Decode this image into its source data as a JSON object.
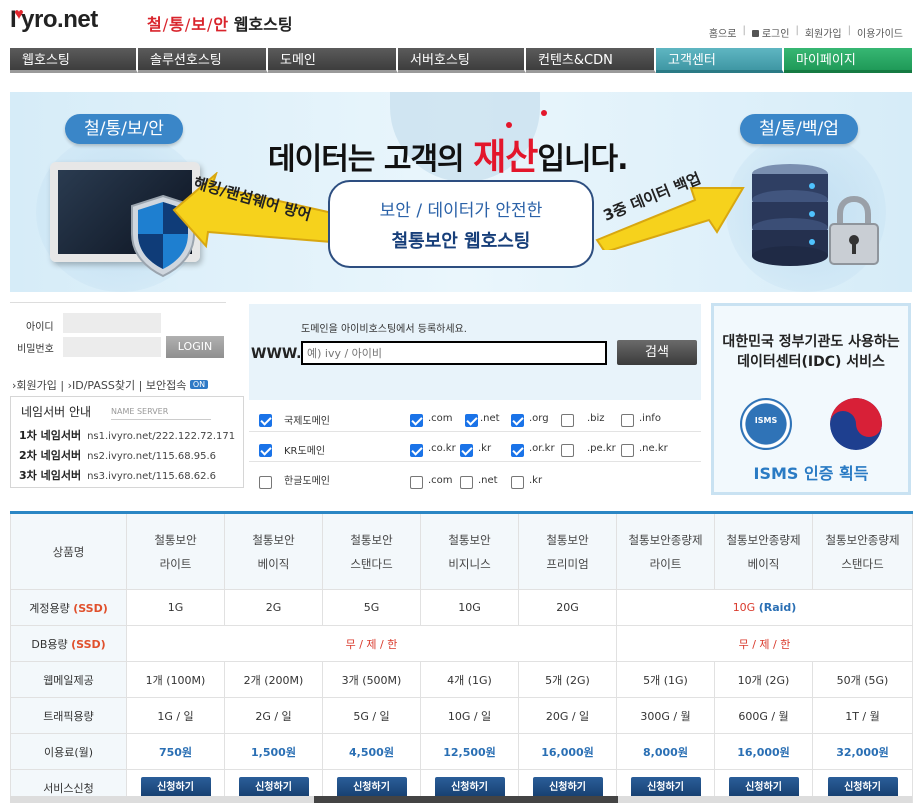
{
  "header": {
    "logo_prefix": "I",
    "logo_suffix": "yro.net",
    "tagline_parts": [
      "철",
      "통",
      "보",
      "안"
    ],
    "tagline_rest": "웹호스팅",
    "toplinks": [
      "홈으로",
      "로그인",
      "회원가입",
      "이용가이드"
    ]
  },
  "nav": [
    {
      "label": "웹호스팅",
      "width": 128
    },
    {
      "label": "솔루션호스팅",
      "width": 130
    },
    {
      "label": "도메인",
      "width": 130
    },
    {
      "label": "서버호스팅",
      "width": 128
    },
    {
      "label": "컨텐츠&CDN",
      "width": 130
    },
    {
      "label": "고객센터",
      "width": 128
    },
    {
      "label": "마이페이지",
      "width": 128
    }
  ],
  "banner": {
    "left_pill": "철/통/보/안",
    "right_pill": "철/통/백/업",
    "headline_pre": "데이터는 고객의 ",
    "headline_accent": "재산",
    "headline_post": "입니다.",
    "center_line1": "보안 / 데이터가 안전한",
    "center_line2": "철통보안 웹호스팅",
    "left_arrow_text": "해킹/랜섬웨어 방어",
    "right_arrow_text": "3중 데이터 백업"
  },
  "login": {
    "id_label": "아이디",
    "pw_label": "비밀번호",
    "button": "LOGIN",
    "links": [
      "회원가입",
      "ID/PASS찾기",
      "보안접속"
    ],
    "on_badge": "ON"
  },
  "nameserver": {
    "title": "네임서버 안내",
    "title_en": "NAME SERVER",
    "rows": [
      {
        "label": "1차 네임서버",
        "value": "ns1.ivyro.net/222.122.72.171"
      },
      {
        "label": "2차 네임서버",
        "value": "ns2.ivyro.net/115.68.95.6"
      },
      {
        "label": "3차 네임서버",
        "value": "ns3.ivyro.net/115.68.62.6"
      }
    ]
  },
  "domain": {
    "hint": "도메인을 아이비호스팅에서 등록하세요.",
    "www": "WWW.",
    "placeholder": "예) ivy / 아이비",
    "search_button": "검색",
    "groups": [
      {
        "label": "국제도메인",
        "checked": true,
        "tlds": [
          {
            "name": ".com",
            "checked": true
          },
          {
            "name": ".net",
            "checked": true
          },
          {
            "name": ".org",
            "checked": true
          },
          {
            "name": ".biz",
            "checked": false
          },
          {
            "name": ".info",
            "checked": false
          }
        ]
      },
      {
        "label": "KR도메인",
        "checked": true,
        "tlds": [
          {
            "name": ".co.kr",
            "checked": true
          },
          {
            "name": ".kr",
            "checked": true
          },
          {
            "name": ".or.kr",
            "checked": true
          },
          {
            "name": ".pe.kr",
            "checked": false
          },
          {
            "name": ".ne.kr",
            "checked": false
          }
        ]
      },
      {
        "label": "한글도메인",
        "checked": false,
        "tlds": [
          {
            "name": ".com",
            "checked": false
          },
          {
            "name": ".net",
            "checked": false
          },
          {
            "name": ".kr",
            "checked": false
          }
        ]
      }
    ]
  },
  "isms": {
    "line1": "대한민국 정부기관도 사용하는",
    "line2": "데이터센터(IDC) 서비스",
    "seal_text": "ISMS",
    "cert": "ISMS 인증 획득"
  },
  "pricing": {
    "header_label": "상품명",
    "products": [
      [
        "철통보안",
        "라이트"
      ],
      [
        "철통보안",
        "베이직"
      ],
      [
        "철통보안",
        "스탠다드"
      ],
      [
        "철통보안",
        "비지니스"
      ],
      [
        "철통보안",
        "프리미엄"
      ],
      [
        "철통보안종량제",
        "라이트"
      ],
      [
        "철통보안종량제",
        "베이직"
      ],
      [
        "철통보안종량제",
        "스탠다드"
      ]
    ],
    "row_storage_label": "계정용량",
    "row_db_label": "DB용량",
    "ssd_tag": "(SSD)",
    "storage_values": [
      "1G",
      "2G",
      "5G",
      "10G",
      "20G"
    ],
    "storage_metered_value": "10G",
    "storage_metered_tag": "(Raid)",
    "db_unlimited": "무 / 제 / 한",
    "webmail_label": "웹메일제공",
    "webmail": [
      "1개 (100M)",
      "2개 (200M)",
      "3개 (500M)",
      "4개 (1G)",
      "5개 (2G)",
      "5개 (1G)",
      "10개 (2G)",
      "50개 (5G)"
    ],
    "traffic_label": "트래픽용량",
    "traffic": [
      "1G / 일",
      "2G / 일",
      "5G / 일",
      "10G / 일",
      "20G / 일",
      "300G / 월",
      "600G / 월",
      "1T / 월"
    ],
    "fee_label": "이용료(월)",
    "fees": [
      "750원",
      "1,500원",
      "4,500원",
      "12,500원",
      "16,000원",
      "8,000원",
      "16,000원",
      "32,000원"
    ],
    "apply_label": "서비스신청",
    "apply_button": "신청하기"
  }
}
